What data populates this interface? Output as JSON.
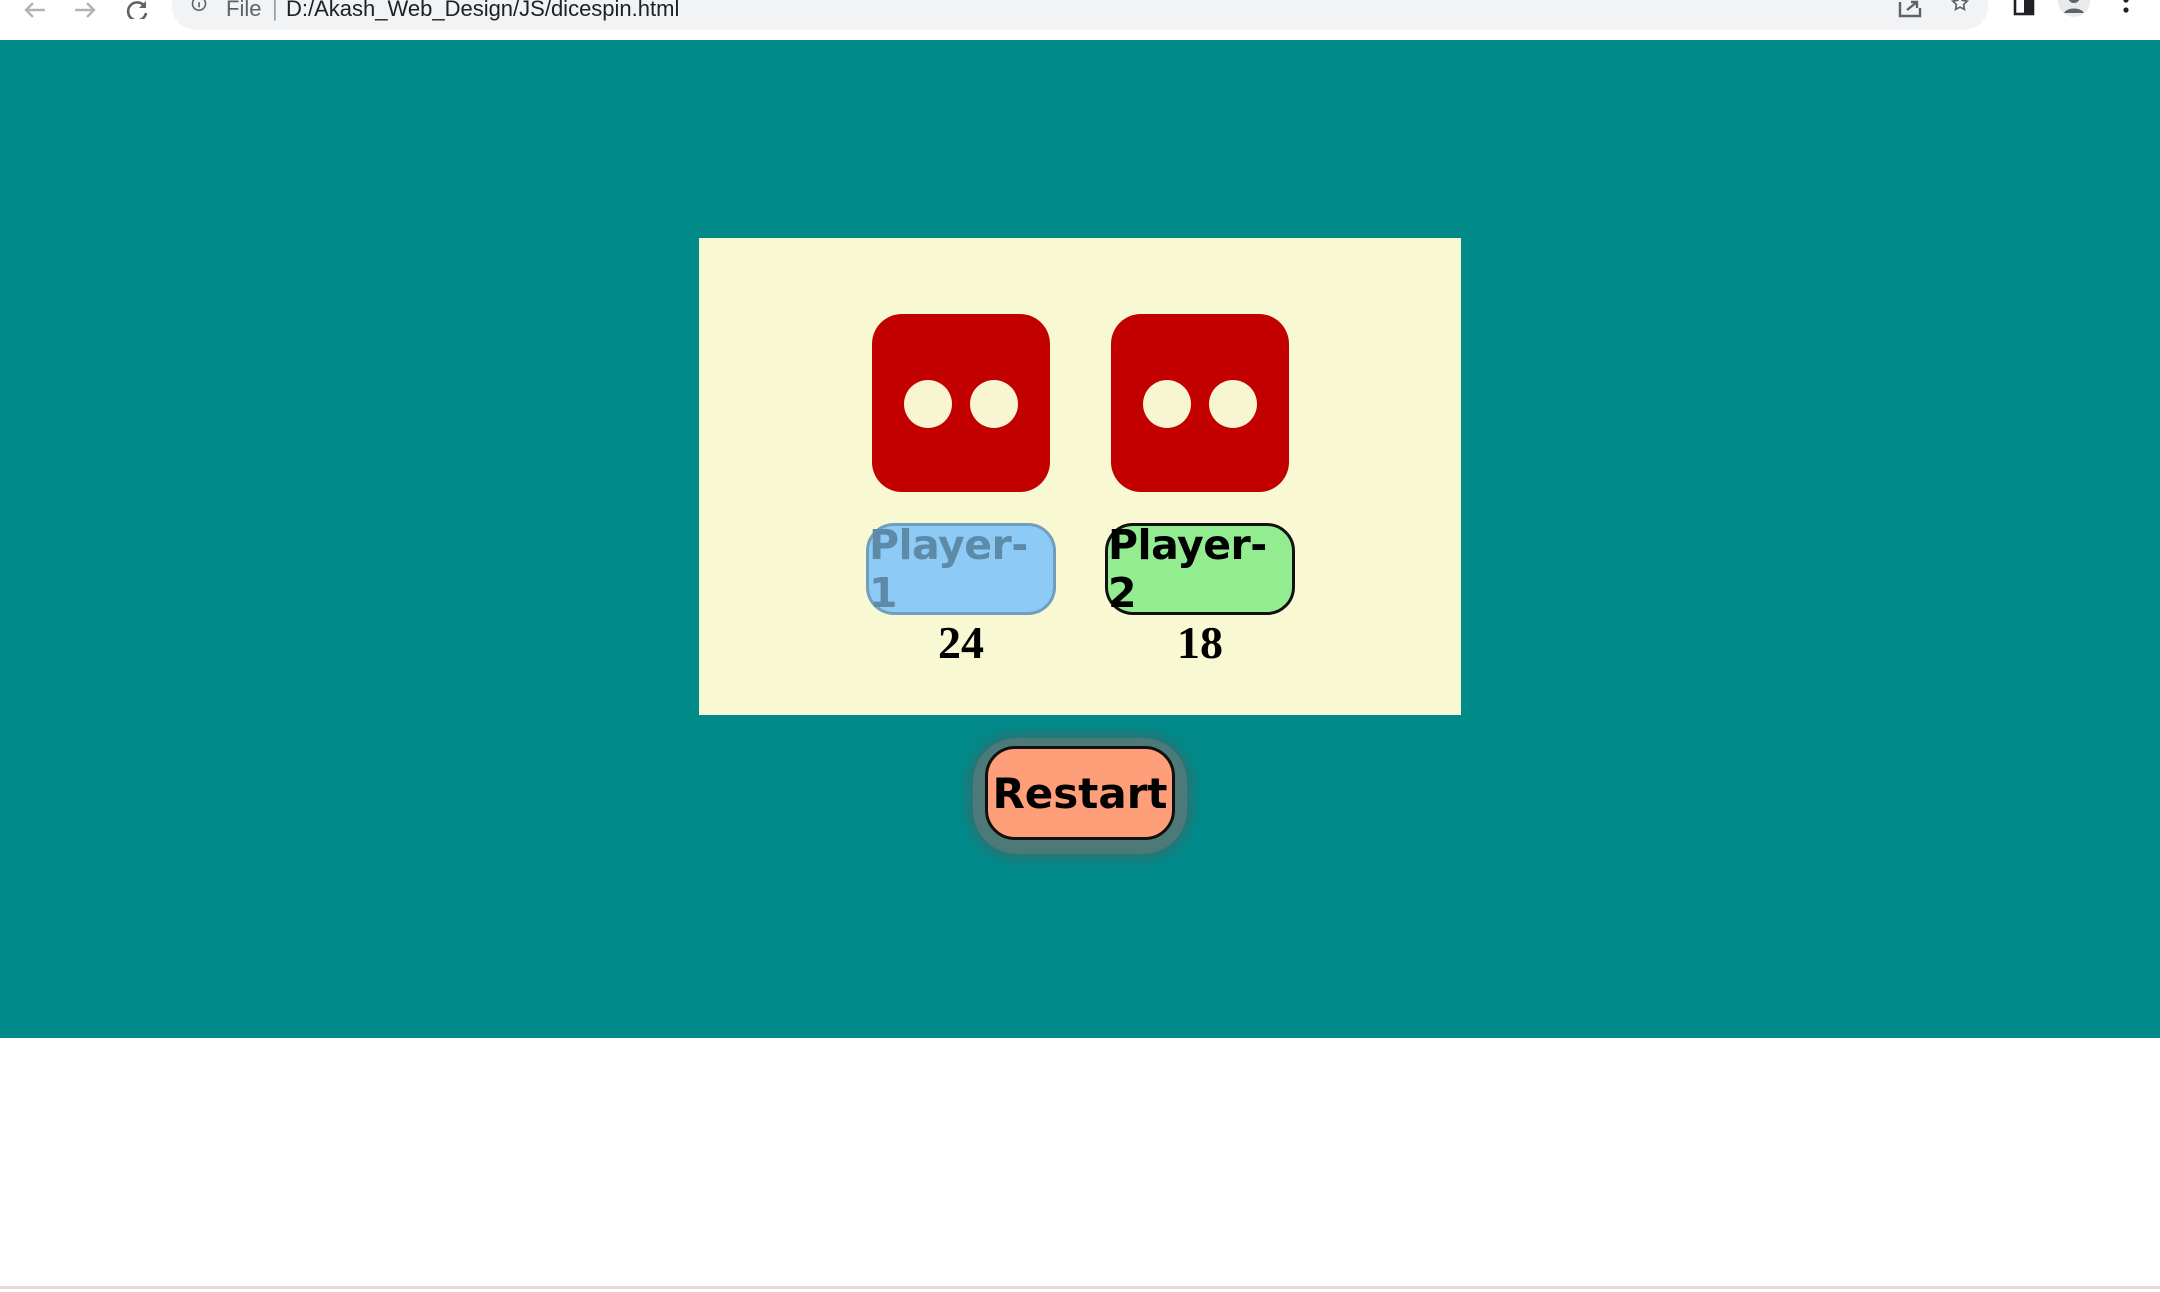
{
  "browser": {
    "scheme_label": "File",
    "separator": "|",
    "url": "D:/Akash_Web_Design/JS/dicespin.html",
    "icons": [
      "back-arrow-icon",
      "forward-arrow-icon",
      "reload-icon",
      "info-icon",
      "share-icon",
      "star-icon",
      "sidepanel-icon",
      "profile-icon",
      "menu-dots-icon"
    ]
  },
  "game": {
    "dice": [
      {
        "player": "Player-1",
        "face_value": 2
      },
      {
        "player": "Player-2",
        "face_value": 2
      }
    ],
    "players": [
      {
        "label": "Player-1",
        "score": "24",
        "active": false
      },
      {
        "label": "Player-2",
        "score": "18",
        "active": true
      }
    ],
    "restart_label": "Restart"
  },
  "colors": {
    "page_background": "#008a8a",
    "panel_background": "#f8f8d2",
    "die_color": "#c30000",
    "pip_color": "#f8f6d2",
    "player1_button": "#8dcbf6",
    "player2_button": "#93ec90",
    "restart_button": "#ff9f7a"
  }
}
